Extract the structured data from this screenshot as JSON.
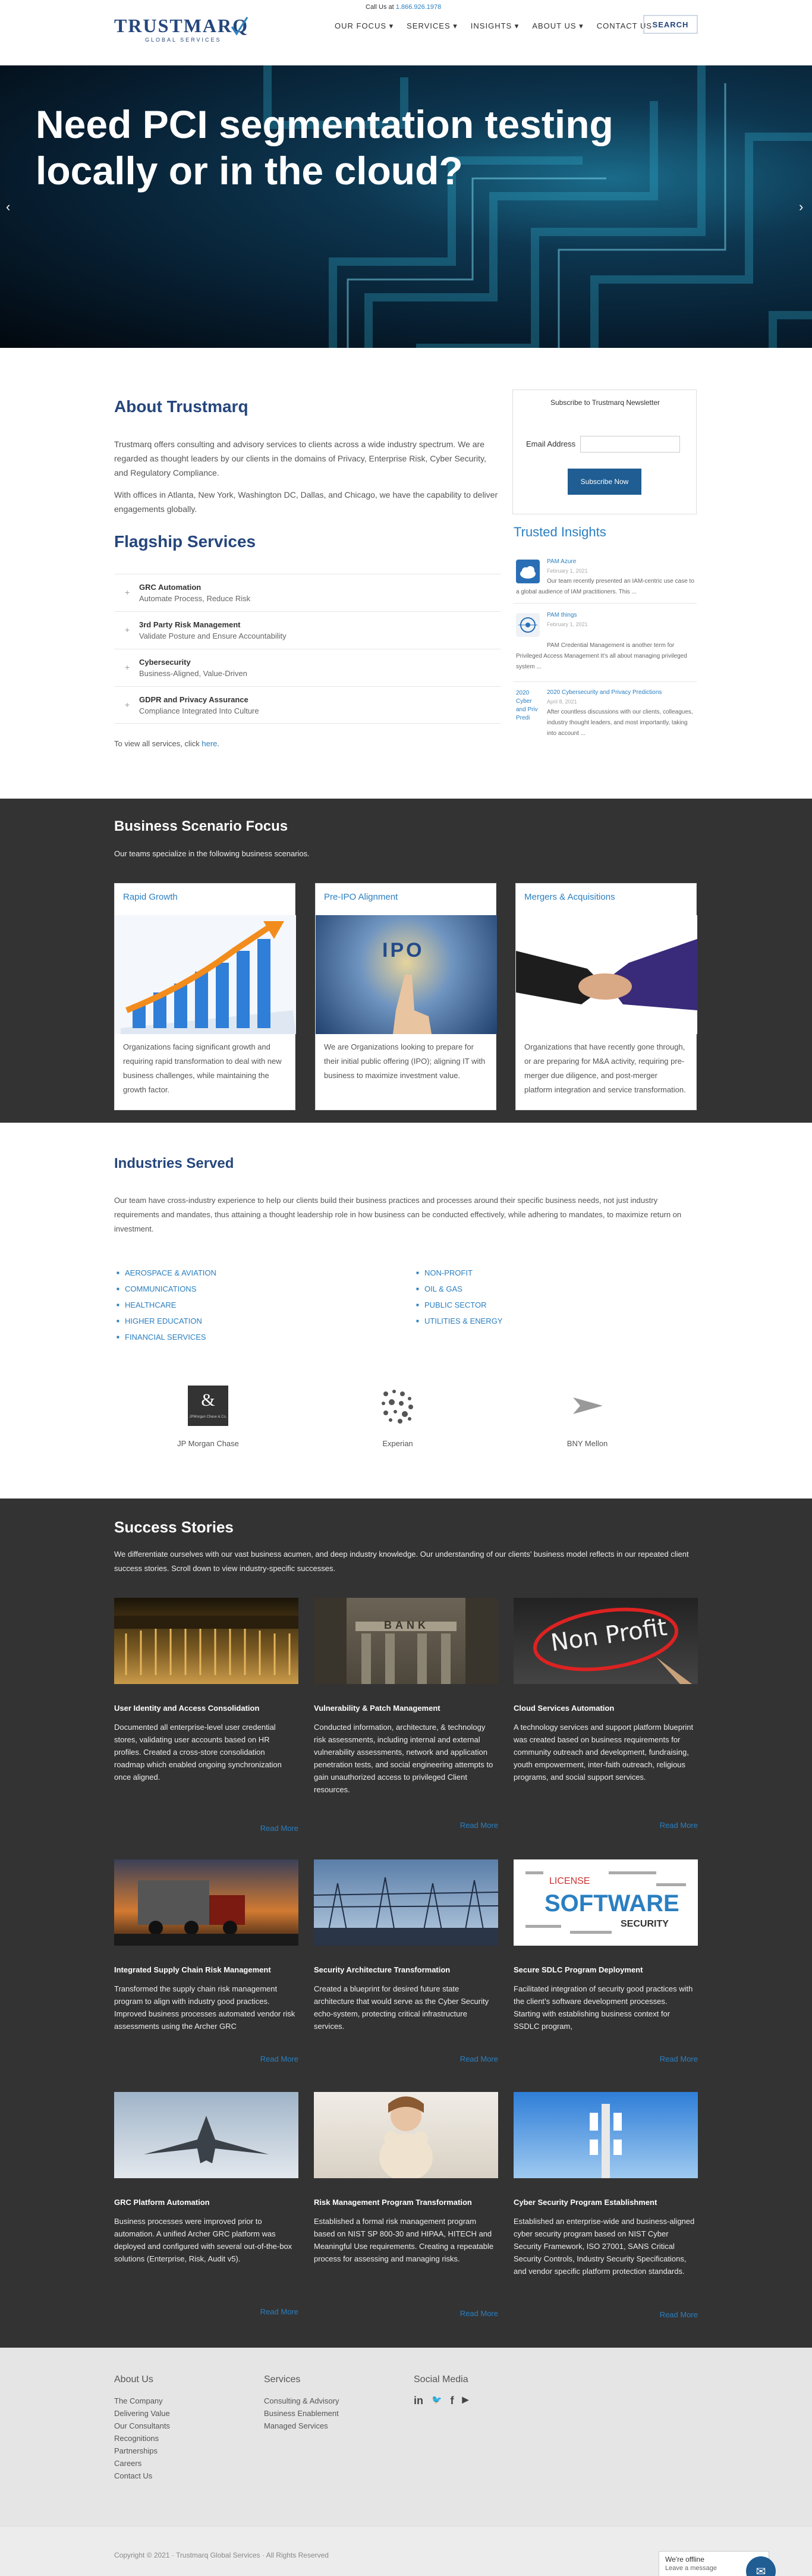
{
  "header": {
    "call_label": "Call Us at ",
    "phone": "1.866.926.1978",
    "logo_main": "TRUSTMARQ",
    "logo_sub": "GLOBAL SERVICES",
    "nav": [
      "OUR FOCUS ▾",
      "SERVICES ▾",
      "INSIGHTS ▾",
      "ABOUT US ▾",
      "CONTACT US"
    ],
    "search_label": "SEARCH"
  },
  "hero": {
    "title_line1": "Need PCI segmentation testing",
    "title_line2": "locally or in the cloud?",
    "prev": "‹",
    "next": "›"
  },
  "about": {
    "title": "About Trustmarq",
    "p1": "Trustmarq offers consulting and advisory services to clients across a wide industry spectrum. We are regarded as thought leaders by our clients in the domains of Privacy, Enterprise Risk, Cyber Security, and Regulatory Compliance.",
    "p2": "With offices in Atlanta, New York, Washington DC, Dallas, and Chicago, we have the capability to deliver engagements globally."
  },
  "flagship": {
    "title": "Flagship Services",
    "items": [
      {
        "title": "GRC Automation",
        "sub": "Automate Process, Reduce Risk"
      },
      {
        "title": "3rd Party Risk Management",
        "sub": "Validate Posture and Ensure Accountability"
      },
      {
        "title": "Cybersecurity",
        "sub": "Business-Aligned, Value-Driven"
      },
      {
        "title": "GDPR and Privacy Assurance",
        "sub": "Compliance Integrated Into Culture"
      }
    ],
    "plus": "+",
    "view_all_prefix": "To view all services, click ",
    "view_all_link": "here",
    "view_all_suffix": "."
  },
  "newsletter": {
    "title": "Subscribe to Trustmarq Newsletter",
    "email_label": "Email Address",
    "button": "Subscribe Now"
  },
  "insights": {
    "title": "Trusted Insights",
    "items": [
      {
        "title": "PAM Azure",
        "date": "February 1, 2021",
        "body": "Our team recently presented an IAM-centric use case to a global audience of IAM practitioners. This ..."
      },
      {
        "title": "PAM things",
        "date": "February 1, 2021",
        "body": "PAM Credential Management is another term for Privileged Access Management It’s all about managing privileged system ..."
      },
      {
        "title": "2020 Cybersecurity and Privacy Predictions",
        "date": "April 8, 2021",
        "body": "After countless discussions with our clients, colleagues, industry thought leaders, and most importantly, taking into account ..."
      }
    ],
    "thumb3_alt": "2020 Cyber and Priv Predi"
  },
  "business": {
    "title": "Business Scenario Focus",
    "subtitle": "Our teams specialize in the following business scenarios.",
    "cards": [
      {
        "title": "Rapid Growth",
        "body": "Organizations facing significant growth and requiring rapid transformation to deal with new business challenges, while maintaining the growth factor."
      },
      {
        "title": "Pre-IPO Alignment",
        "body": "We are Organizations looking to prepare for their initial public offering (IPO); aligning IT with business to maximize investment value."
      },
      {
        "title": "Mergers & Acquisitions",
        "body": "Organizations that have recently gone through, or are preparing for M&A activity, requiring pre-merger due diligence, and post-merger platform integration and service transformation."
      }
    ],
    "ipo_label": "IPO"
  },
  "industries": {
    "title": "Industries Served",
    "body": "Our team have cross-industry experience to help our clients build their business practices and processes around their specific business needs, not just industry requirements and mandates, thus attaining a thought leadership role in how business can be conducted effectively, while adhering to mandates, to maximize return on investment.",
    "left": [
      "Aerospace & Aviation",
      "Communications",
      "Healthcare",
      "Higher Education",
      "Financial Services"
    ],
    "right": [
      "Non-Profit",
      "Oil & Gas",
      "Public Sector",
      "Utilities & Energy"
    ],
    "clients": [
      "JP Morgan Chase",
      "Experian",
      "BNY Mellon"
    ],
    "jpm_logo_text": "JPMorgan Chase & Co."
  },
  "success": {
    "title": "Success Stories",
    "body": "We differentiate ourselves with our vast business acumen, and deep industry knowledge. Our understanding of our clients’ business model reflects in our repeated client success stories. Scroll down to view industry-specific successes.",
    "read_more": "Read More",
    "cards": [
      {
        "title": "User Identity and Access Consolidation",
        "body": "Documented all enterprise-level user credential stores, validating user accounts based on HR profiles. Created a cross-store consolidation roadmap which enabled ongoing synchronization once aligned."
      },
      {
        "title": "Vulnerability & Patch Management",
        "body": "Conducted information, architecture, & technology risk assessments, including internal and external vulnerability assessments, network and application penetration tests, and social engineering attempts to gain unauthorized access to privileged Client resources."
      },
      {
        "title": "Cloud Services Automation",
        "body": "A technology services and support platform blueprint was created based on business requirements for community outreach and development, fundraising, youth empowerment, inter-faith outreach, religious programs, and social support services."
      },
      {
        "title": "Integrated Supply Chain Risk Management",
        "body": "Transformed the supply chain risk management program to align with industry good practices. Improved business processes automated vendor risk assessments using the Archer GRC"
      },
      {
        "title": "Security Architecture Transformation",
        "body": "Created a blueprint for desired future state architecture that would serve as the Cyber Security echo-system, protecting critical infrastructure services."
      },
      {
        "title": "Secure SDLC Program Deployment",
        "body": "Facilitated integration of security good practices with the client’s software development processes. Starting with establishing business context for SSDLC program,"
      },
      {
        "title": "GRC Platform Automation",
        "body": "Business processes were improved prior to automation. A unified Archer GRC platform was deployed and configured with several out-of-the-box solutions (Enterprise, Risk, Audit v5)."
      },
      {
        "title": "Risk Management Program Transformation",
        "body": "Established a formal risk management program based on NIST SP 800-30 and HIPAA, HITECH and Meaningful Use requirements. Creating a repeatable process for assessing and managing risks."
      },
      {
        "title": "Cyber Security Program Establishment",
        "body": "Established an enterprise-wide and business-aligned cyber security program based on NIST Cyber Security Framework, ISO 27001, SANS Critical Security Controls, Industry Security Specifications, and vendor specific platform protection standards."
      }
    ],
    "img_text_bank": "BANK",
    "img_text_nonprofit": "Non Profit",
    "img_text_software": "SOFTWARE",
    "img_text_license": "LICENSE",
    "img_text_security": "SECURITY"
  },
  "footer": {
    "about_title": "About Us",
    "about_items": [
      "The Company",
      "Delivering Value",
      "Our Consultants",
      "Recognitions",
      "Partnerships",
      "Careers",
      "Contact Us"
    ],
    "services_title": "Services",
    "services_items": [
      "Consulting & Advisory",
      "Business Enablement",
      "Managed Services"
    ],
    "social_title": "Social Media",
    "social_icons": [
      "in",
      "🐦",
      "f",
      "▶"
    ],
    "copyright": "Copyright © 2021 · Trustmarq Global Services · All Rights Reserved"
  },
  "chat": {
    "title": "We're offline",
    "sub": "Leave a message"
  }
}
